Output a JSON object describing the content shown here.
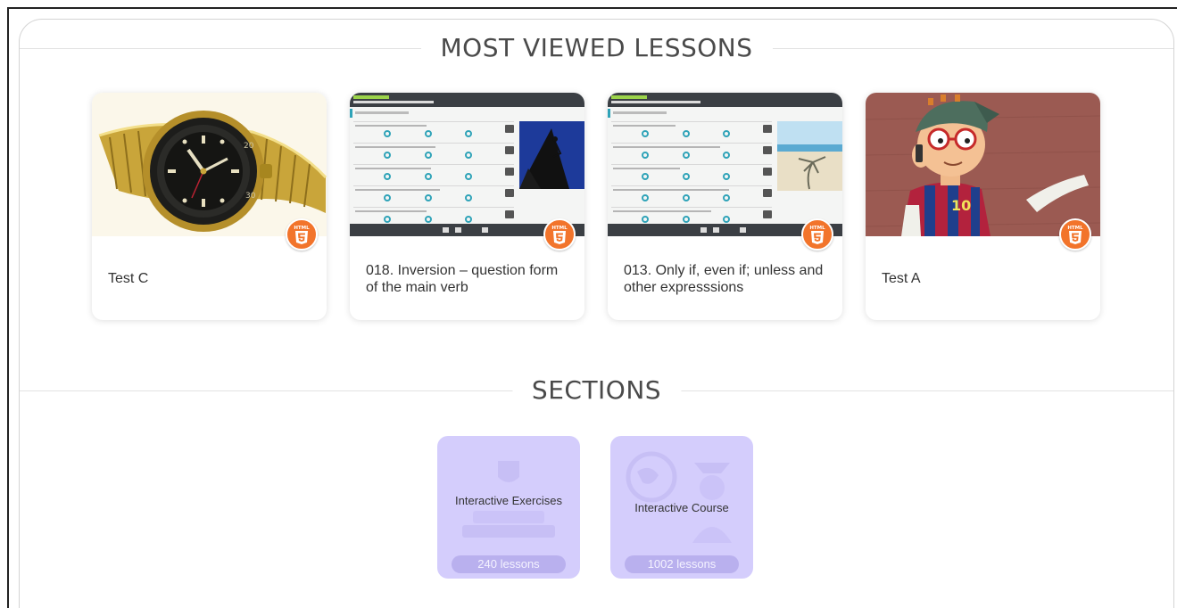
{
  "headings": {
    "most_viewed": "MOST VIEWED LESSONS",
    "sections": "SECTIONS"
  },
  "lessons": [
    {
      "title": "Test C",
      "thumbnail": "gold-watch",
      "badge": "HTML"
    },
    {
      "title": "018. Inversion – question form of the main verb",
      "thumbnail": "grammar-exercise-climber",
      "badge": "HTML"
    },
    {
      "title": "013. Only if, even if; unless and other expresssions",
      "thumbnail": "grammar-exercise-beach",
      "badge": "HTML"
    },
    {
      "title": "Test A",
      "thumbnail": "cartoon-boy",
      "badge": "HTML"
    }
  ],
  "sections": [
    {
      "title": "Interactive Exercises",
      "count": "240 lessons",
      "icon": "exercises-emblem-icon"
    },
    {
      "title": "Interactive Course",
      "count": "1002 lessons",
      "icon": "globe-graduate-icon"
    }
  ],
  "colors": {
    "badge": "#f2742b",
    "section_card": "#d4cdfc",
    "exercise_header": "#3b3f44"
  }
}
